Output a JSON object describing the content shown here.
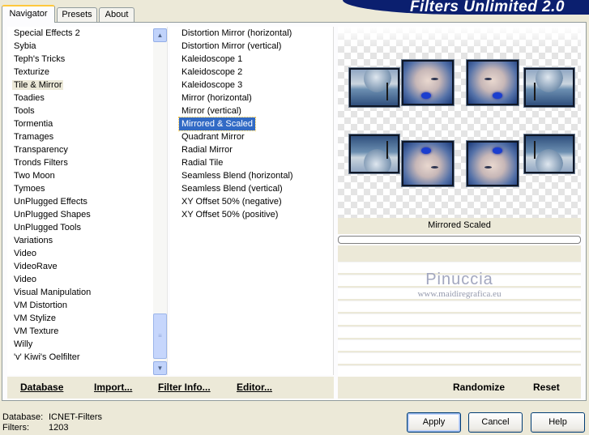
{
  "tabs": [
    {
      "label": "Navigator"
    },
    {
      "label": "Presets"
    },
    {
      "label": "About"
    }
  ],
  "banner": {
    "title": "Filters Unlimited 2.0",
    "color": "#0b1f6f"
  },
  "categories": [
    "Special Effects 2",
    "Sybia",
    "Teph's Tricks",
    "Texturize",
    "Tile & Mirror",
    "Toadies",
    "Tools",
    "Tormentia",
    "Tramages",
    "Transparency",
    "Tronds Filters",
    "Two Moon",
    "Tymoes",
    "UnPlugged Effects",
    "UnPlugged Shapes",
    "UnPlugged Tools",
    "Variations",
    "Video",
    "VideoRave",
    "Video",
    "Visual Manipulation",
    "VM Distortion",
    "VM Stylize",
    "VM Texture",
    "Willy",
    "'v' Kiwi's Oelfilter"
  ],
  "selected_category": "Tile & Mirror",
  "filters": [
    "Distortion Mirror (horizontal)",
    "Distortion Mirror (vertical)",
    "Kaleidoscope 1",
    "Kaleidoscope 2",
    "Kaleidoscope 3",
    "Mirror (horizontal)",
    "Mirror (vertical)",
    "Mirrored & Scaled",
    "Quadrant Mirror",
    "Radial Mirror",
    "Radial Tile",
    "Seamless Blend (horizontal)",
    "Seamless Blend (vertical)",
    "XY Offset 50% (negative)",
    "XY Offset 50% (positive)"
  ],
  "selected_filter": "Mirrored & Scaled",
  "left_buttons": {
    "database": "Database",
    "import": "Import...",
    "filter_info": "Filter Info...",
    "editor": "Editor..."
  },
  "preview": {
    "filter_name": "Mirrored  Scaled",
    "watermark_title": "Pinuccia",
    "watermark_url": "www.maidiregrafica.eu"
  },
  "right_buttons": {
    "randomize": "Randomize",
    "reset": "Reset"
  },
  "footer": {
    "database_label": "Database:",
    "database_value": "ICNET-Filters",
    "filters_label": "Filters:",
    "filters_value": "1203"
  },
  "dialog_buttons": {
    "apply": "Apply",
    "cancel": "Cancel",
    "help": "Help"
  },
  "colors": {
    "selection": "#316ac5",
    "background": "#ece9d8",
    "accent_tab": "#ffc83c"
  }
}
